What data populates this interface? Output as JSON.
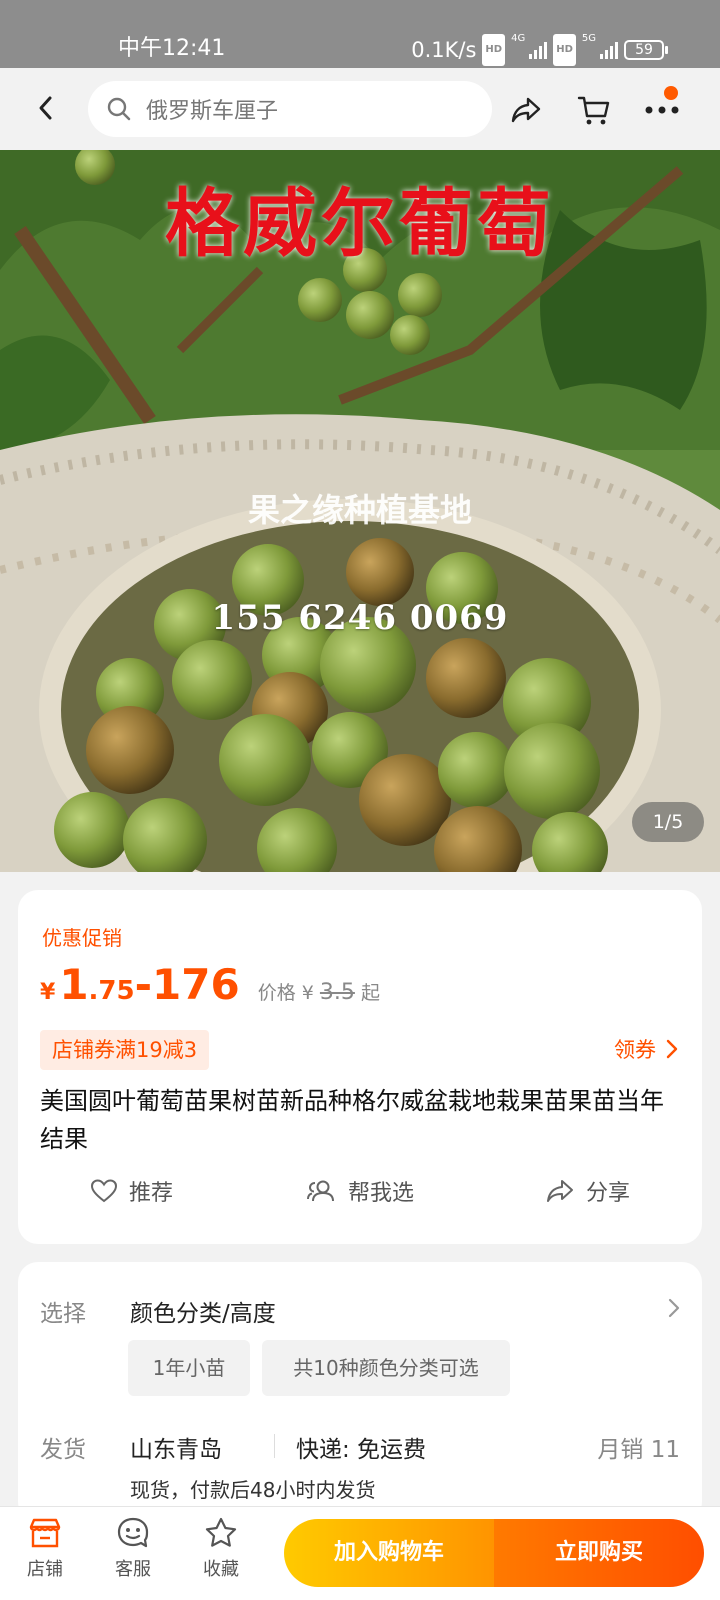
{
  "status_bar": {
    "time": "中午12:41",
    "net_speed": "0.1K/s",
    "hd1": "HD",
    "net1": "4G",
    "hd2": "HD",
    "net2": "5G",
    "battery": "59"
  },
  "nav": {
    "search_placeholder": "俄罗斯车厘子",
    "icons": [
      "back-icon",
      "search-icon",
      "share-icon",
      "cart-icon",
      "more-icon"
    ],
    "badge_color": "#ff5a00"
  },
  "gallery": {
    "banner_title": "格威尔葡萄",
    "watermark": "果之缘种植基地",
    "phone": "155 6246 0069",
    "counter": "1/5"
  },
  "product": {
    "promo_label": "优惠促销",
    "currency": "¥",
    "price_low_int": "1",
    "price_low_dec": ".75",
    "price_dash": "-",
    "price_high": "176",
    "orig_label": "价格 ¥",
    "orig_price": "3.5",
    "orig_suffix": "起",
    "coupon": "店铺券满19减3",
    "get_coupon": "领券",
    "title": "美国圆叶葡萄苗果树苗新品种格尔威盆栽地栽果苗果苗当年结果",
    "actions": [
      {
        "label": "推荐",
        "icon": "heart-icon"
      },
      {
        "label": "帮我选",
        "icon": "users-icon"
      },
      {
        "label": "分享",
        "icon": "share-icon"
      }
    ]
  },
  "options": {
    "select_label": "选择",
    "select_title": "颜色分类/高度",
    "chips": [
      "1年小苗",
      "共10种颜色分类可选"
    ],
    "ship_label": "发货",
    "ship_location": "山东青岛",
    "ship_method": "快递: 免运费",
    "monthly_sales": "月销  11",
    "ship_note": "现货，付款后48小时内发货"
  },
  "bottom": {
    "tabs": [
      {
        "label": "店铺",
        "icon": "store-icon"
      },
      {
        "label": "客服",
        "icon": "service-icon"
      },
      {
        "label": "收藏",
        "icon": "star-icon"
      }
    ],
    "add_cart": "加入购物车",
    "buy_now": "立即购买",
    "accent": "#ff5000"
  }
}
